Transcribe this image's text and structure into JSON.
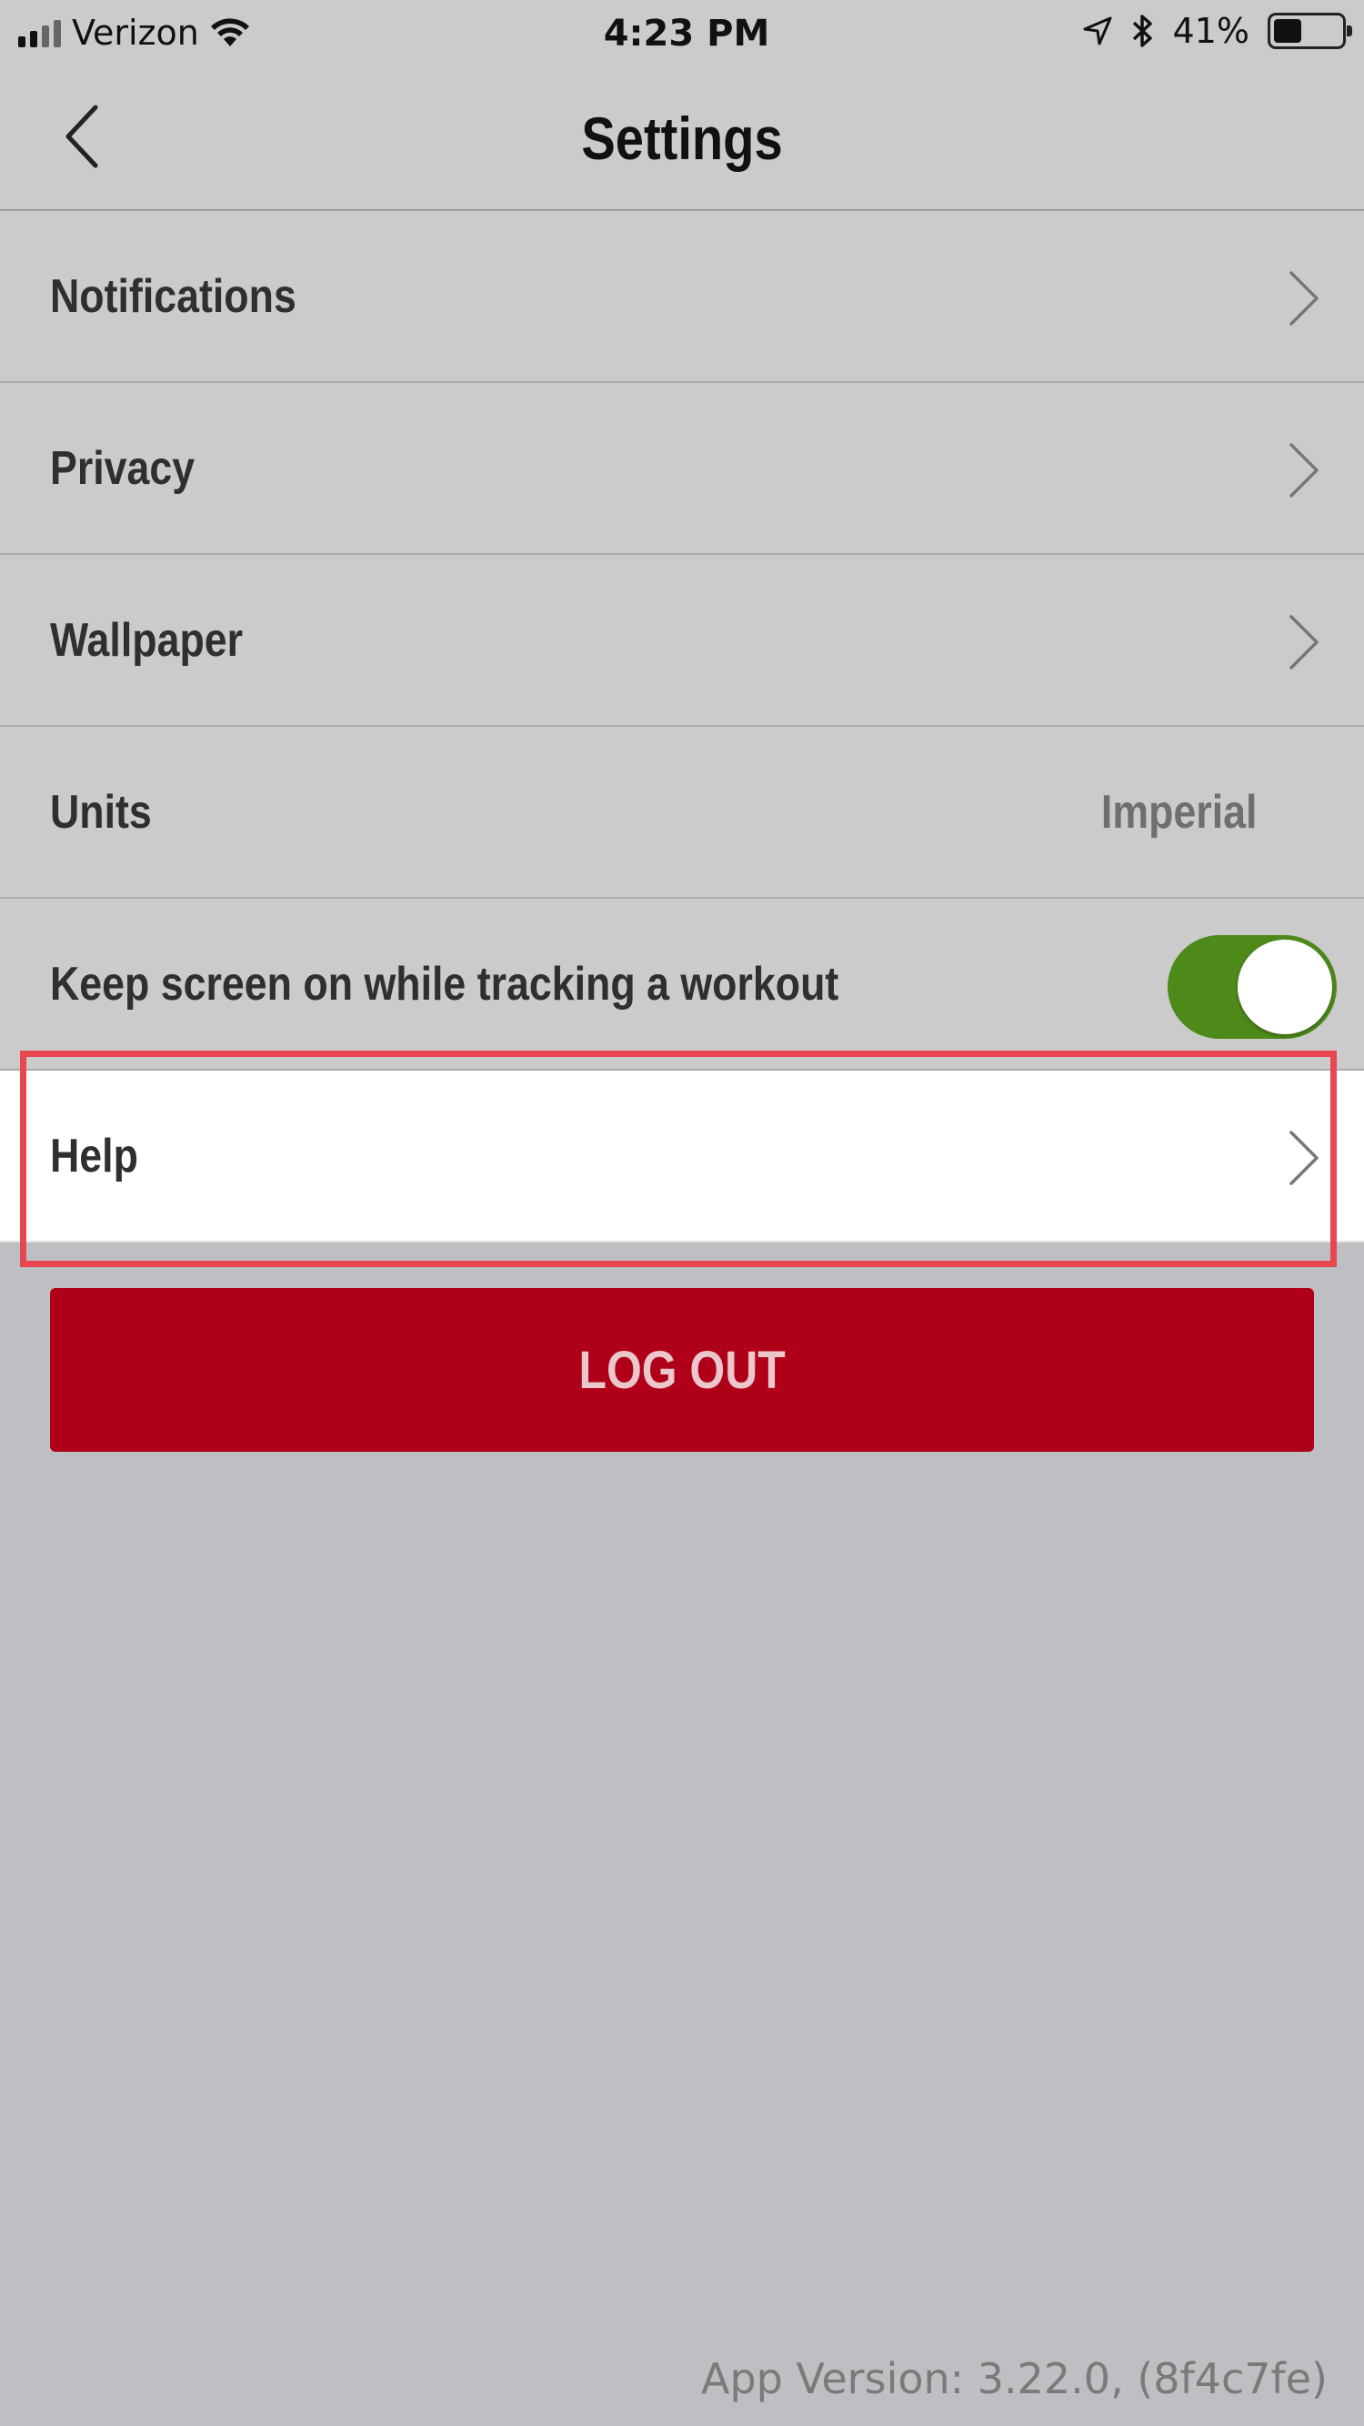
{
  "status_bar": {
    "carrier": "Verizon",
    "time": "4:23 PM",
    "battery_percent": "41%",
    "battery_level": 0.41,
    "icons": [
      "signal-icon",
      "wifi-icon",
      "location-arrow-icon",
      "bluetooth-icon",
      "battery-icon"
    ]
  },
  "nav": {
    "title": "Settings",
    "back_icon": "chevron-left-icon"
  },
  "settings": {
    "rows": [
      {
        "label": "Notifications"
      },
      {
        "label": "Privacy"
      },
      {
        "label": "Wallpaper"
      },
      {
        "label": "Units",
        "value": "Imperial"
      },
      {
        "label": "Keep screen on while tracking a workout",
        "toggle_on": true
      },
      {
        "label": "Help"
      }
    ]
  },
  "logout": {
    "label": "LOG OUT"
  },
  "footer": {
    "app_version": "App Version: 3.22.0, (8f4c7fe)"
  },
  "colors": {
    "background": "#bebfc3",
    "row": "#cbcbcb",
    "accent_red": "#b00019",
    "toggle_green": "#4e8a1a",
    "highlight": "#e8474f"
  }
}
